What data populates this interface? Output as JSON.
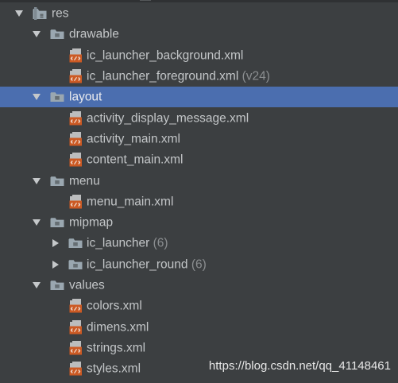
{
  "colors": {
    "background": "#3c3f41",
    "selection": "#4b6eaf",
    "text": "#c3c6c8",
    "secondary_text": "#8b8e90",
    "folder_icon": "#9aa7b0",
    "xml_icon_orange": "#cc5a24",
    "xml_icon_gray": "#bcbdbe"
  },
  "tree": {
    "res": {
      "label": "res",
      "icon": "res-folder-icon",
      "expanded": true
    },
    "drawable": {
      "label": "drawable",
      "icon": "folder-icon",
      "expanded": true
    },
    "ic_launcher_background": {
      "label": "ic_launcher_background.xml",
      "icon": "xml-file-icon"
    },
    "ic_launcher_foreground": {
      "label": "ic_launcher_foreground.xml",
      "suffix": "(v24)",
      "icon": "xml-file-icon"
    },
    "layout": {
      "label": "layout",
      "icon": "folder-icon",
      "expanded": true,
      "selected": true
    },
    "activity_display_message": {
      "label": "activity_display_message.xml",
      "icon": "xml-file-icon"
    },
    "activity_main": {
      "label": "activity_main.xml",
      "icon": "xml-file-icon"
    },
    "content_main": {
      "label": "content_main.xml",
      "icon": "xml-file-icon"
    },
    "menu": {
      "label": "menu",
      "icon": "folder-icon",
      "expanded": true
    },
    "menu_main": {
      "label": "menu_main.xml",
      "icon": "xml-file-icon"
    },
    "mipmap": {
      "label": "mipmap",
      "icon": "folder-icon",
      "expanded": true
    },
    "ic_launcher": {
      "label": "ic_launcher",
      "suffix": "(6)",
      "icon": "folder-icon",
      "expanded": false
    },
    "ic_launcher_round": {
      "label": "ic_launcher_round",
      "suffix": "(6)",
      "icon": "folder-icon",
      "expanded": false
    },
    "values": {
      "label": "values",
      "icon": "folder-icon",
      "expanded": true
    },
    "colors": {
      "label": "colors.xml",
      "icon": "xml-file-icon"
    },
    "dimens": {
      "label": "dimens.xml",
      "icon": "xml-file-icon"
    },
    "strings": {
      "label": "strings.xml",
      "icon": "xml-file-icon"
    },
    "styles": {
      "label": "styles.xml",
      "icon": "xml-file-icon"
    }
  },
  "watermark": "https://blog.csdn.net/qq_41148461"
}
